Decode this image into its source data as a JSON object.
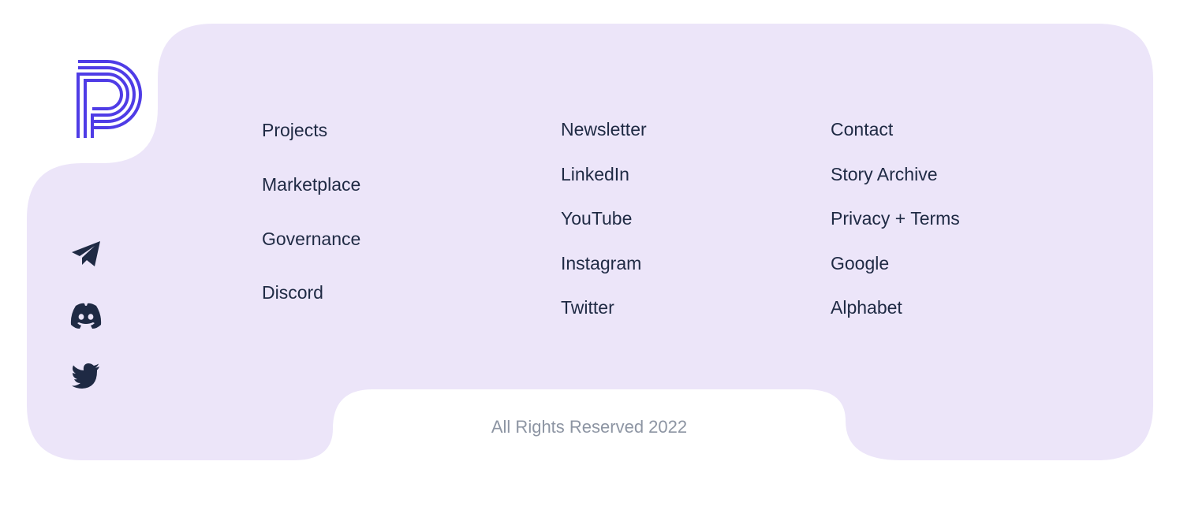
{
  "brand": {
    "logo_icon": "p-logo-icon",
    "accent_color": "#4f3ce6",
    "footer_bg": "#ece5f9",
    "text_color": "#1f2a44"
  },
  "social": [
    {
      "name": "telegram",
      "icon": "telegram-icon"
    },
    {
      "name": "discord",
      "icon": "discord-icon"
    },
    {
      "name": "twitter",
      "icon": "twitter-bird-icon"
    }
  ],
  "columns": [
    {
      "links": [
        "Projects",
        "Marketplace",
        "Governance",
        "Discord"
      ]
    },
    {
      "links": [
        "Newsletter",
        "LinkedIn",
        "YouTube",
        "Instagram",
        "Twitter"
      ]
    },
    {
      "links": [
        "Contact",
        "Story Archive",
        "Privacy + Terms",
        "Google",
        "Alphabet"
      ]
    }
  ],
  "copyright": "All Rights Reserved 2022"
}
